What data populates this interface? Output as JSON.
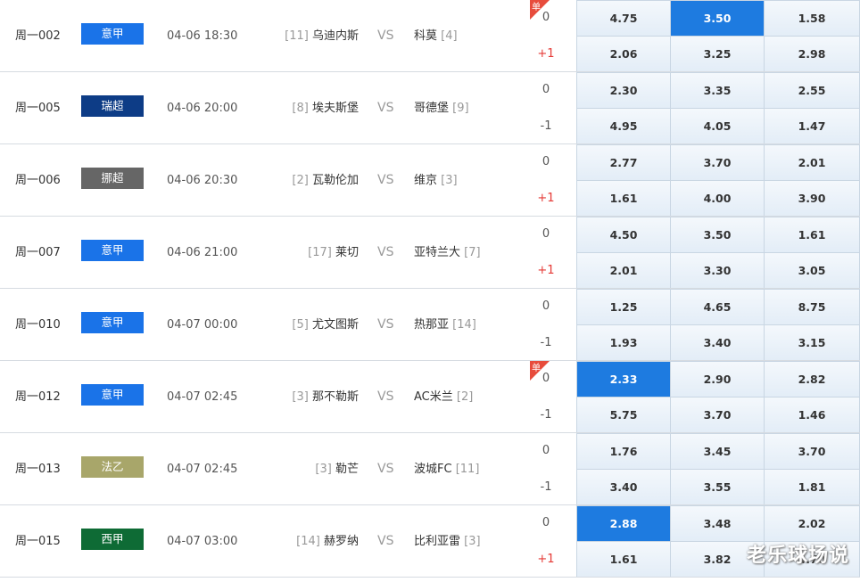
{
  "rows": [
    {
      "num": "周一002",
      "league": "意甲",
      "league_color": "#1a73e8",
      "time": "04-06 18:30",
      "home_rank": "[11]",
      "home": "乌迪内斯",
      "vs": "VS",
      "away": "科莫",
      "away_rank": "[4]",
      "single": true,
      "hc": [
        "0",
        "+1"
      ],
      "odds": [
        [
          "4.75",
          "3.50",
          "1.58"
        ],
        [
          "2.06",
          "3.25",
          "2.98"
        ]
      ],
      "sel": [
        [
          false,
          true,
          false
        ],
        [
          false,
          false,
          false
        ]
      ]
    },
    {
      "num": "周一005",
      "league": "瑞超",
      "league_color": "#0d3c86",
      "time": "04-06 20:00",
      "home_rank": "[8]",
      "home": "埃夫斯堡",
      "vs": "VS",
      "away": "哥德堡",
      "away_rank": "[9]",
      "single": false,
      "hc": [
        "0",
        "-1"
      ],
      "odds": [
        [
          "2.30",
          "3.35",
          "2.55"
        ],
        [
          "4.95",
          "4.05",
          "1.47"
        ]
      ],
      "sel": [
        [
          false,
          false,
          false
        ],
        [
          false,
          false,
          false
        ]
      ]
    },
    {
      "num": "周一006",
      "league": "挪超",
      "league_color": "#666666",
      "time": "04-06 20:30",
      "home_rank": "[2]",
      "home": "瓦勒伦加",
      "vs": "VS",
      "away": "维京",
      "away_rank": "[3]",
      "single": false,
      "hc": [
        "0",
        "+1"
      ],
      "odds": [
        [
          "2.77",
          "3.70",
          "2.01"
        ],
        [
          "1.61",
          "4.00",
          "3.90"
        ]
      ],
      "sel": [
        [
          false,
          false,
          false
        ],
        [
          false,
          false,
          false
        ]
      ]
    },
    {
      "num": "周一007",
      "league": "意甲",
      "league_color": "#1a73e8",
      "time": "04-06 21:00",
      "home_rank": "[17]",
      "home": "莱切",
      "vs": "VS",
      "away": "亚特兰大",
      "away_rank": "[7]",
      "single": false,
      "hc": [
        "0",
        "+1"
      ],
      "odds": [
        [
          "4.50",
          "3.50",
          "1.61"
        ],
        [
          "2.01",
          "3.30",
          "3.05"
        ]
      ],
      "sel": [
        [
          false,
          false,
          false
        ],
        [
          false,
          false,
          false
        ]
      ]
    },
    {
      "num": "周一010",
      "league": "意甲",
      "league_color": "#1a73e8",
      "time": "04-07 00:00",
      "home_rank": "[5]",
      "home": "尤文图斯",
      "vs": "VS",
      "away": "热那亚",
      "away_rank": "[14]",
      "single": false,
      "hc": [
        "0",
        "-1"
      ],
      "odds": [
        [
          "1.25",
          "4.65",
          "8.75"
        ],
        [
          "1.93",
          "3.40",
          "3.15"
        ]
      ],
      "sel": [
        [
          false,
          false,
          false
        ],
        [
          false,
          false,
          false
        ]
      ]
    },
    {
      "num": "周一012",
      "league": "意甲",
      "league_color": "#1a73e8",
      "time": "04-07 02:45",
      "home_rank": "[3]",
      "home": "那不勒斯",
      "vs": "VS",
      "away": "AC米兰",
      "away_rank": "[2]",
      "single": true,
      "hc": [
        "0",
        "-1"
      ],
      "odds": [
        [
          "2.33",
          "2.90",
          "2.82"
        ],
        [
          "5.75",
          "3.70",
          "1.46"
        ]
      ],
      "sel": [
        [
          true,
          false,
          false
        ],
        [
          false,
          false,
          false
        ]
      ]
    },
    {
      "num": "周一013",
      "league": "法乙",
      "league_color": "#a8a66a",
      "time": "04-07 02:45",
      "home_rank": "[3]",
      "home": "勒芒",
      "vs": "VS",
      "away": "波城FC",
      "away_rank": "[11]",
      "single": false,
      "hc": [
        "0",
        "-1"
      ],
      "odds": [
        [
          "1.76",
          "3.45",
          "3.70"
        ],
        [
          "3.40",
          "3.55",
          "1.81"
        ]
      ],
      "sel": [
        [
          false,
          false,
          false
        ],
        [
          false,
          false,
          false
        ]
      ]
    },
    {
      "num": "周一015",
      "league": "西甲",
      "league_color": "#0e6b35",
      "time": "04-07 03:00",
      "home_rank": "[14]",
      "home": "赫罗纳",
      "vs": "VS",
      "away": "比利亚雷",
      "away_rank": "[3]",
      "single": false,
      "hc": [
        "0",
        "+1"
      ],
      "odds": [
        [
          "2.88",
          "3.48",
          "2.02"
        ],
        [
          "1.61",
          "3.82",
          "4.70"
        ]
      ],
      "sel": [
        [
          true,
          false,
          false
        ],
        [
          false,
          false,
          false
        ]
      ]
    }
  ],
  "single_label": "单",
  "watermark": "老乐球场说"
}
